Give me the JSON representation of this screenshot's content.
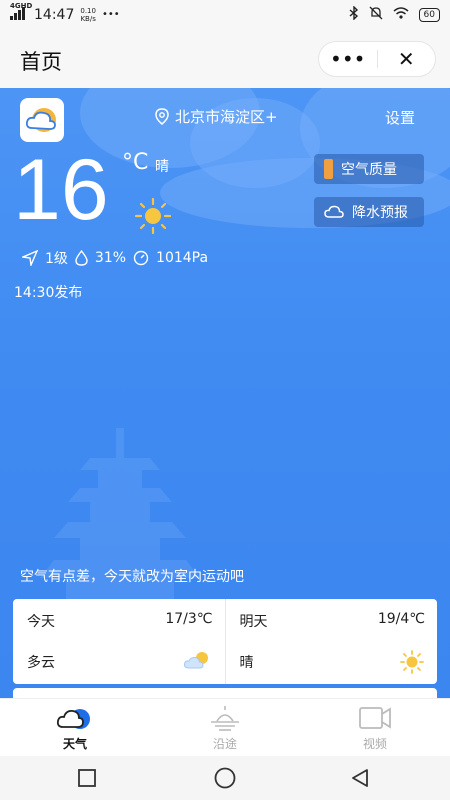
{
  "status_bar": {
    "network": "4GHD",
    "time": "14:47",
    "speed_value": "0.10",
    "speed_unit": "KB/s",
    "dots": "•••",
    "battery": "60"
  },
  "nav": {
    "title": "首页",
    "more": "•••",
    "close": "✕"
  },
  "weather": {
    "location": "北京市海淀区+",
    "settings": "设置",
    "temperature": "16",
    "unit": "°C",
    "condition": "晴",
    "air_quality": "空气质量",
    "rain_forecast": "降水预报",
    "wind": "1级",
    "humidity": "31%",
    "pressure": "1014Pa",
    "publish_time": "14:30发布",
    "tip": "空气有点差，今天就改为室内运动吧"
  },
  "forecast": [
    {
      "day": "今天",
      "range": "17/3℃",
      "condition": "多云",
      "icon": "partly-cloudy-icon"
    },
    {
      "day": "明天",
      "range": "19/4℃",
      "condition": "晴",
      "icon": "sun-icon"
    }
  ],
  "tabs": [
    {
      "label": "天气",
      "icon": "weather-icon",
      "active": true
    },
    {
      "label": "沿途",
      "icon": "horizon-icon",
      "active": false
    },
    {
      "label": "视频",
      "icon": "video-icon",
      "active": false
    }
  ],
  "colors": {
    "accent": "#1e6fe6",
    "sky_top": "#4d95f5",
    "sky_bottom": "#3c86ef",
    "air_badge": "#f0a040"
  }
}
